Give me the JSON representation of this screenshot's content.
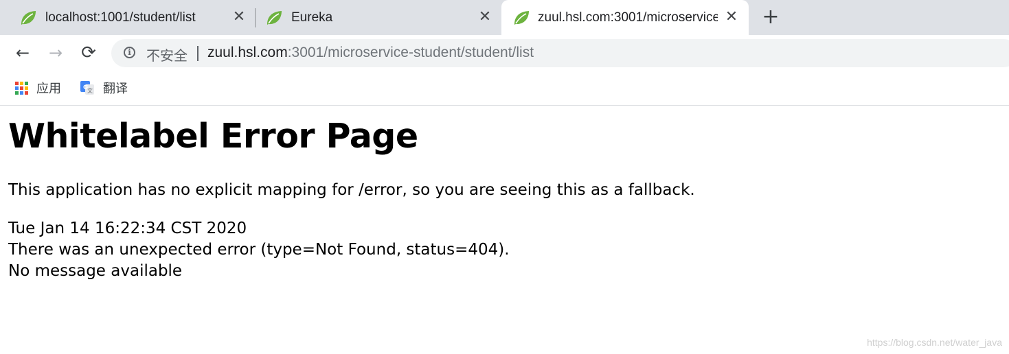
{
  "browser": {
    "tabs": [
      {
        "title": "localhost:1001/student/list",
        "active": false,
        "favicon": "spring-leaf-icon"
      },
      {
        "title": "Eureka",
        "active": false,
        "favicon": "spring-leaf-icon"
      },
      {
        "title": "zuul.hsl.com:3001/microservice",
        "active": true,
        "favicon": "spring-leaf-icon"
      }
    ],
    "new_tab_glyph": "+",
    "close_glyph": "✕",
    "toolbar": {
      "back_glyph": "←",
      "forward_glyph": "→",
      "reload_glyph": "⟳",
      "info_glyph": "i",
      "security_label": "不安全",
      "url_host": "zuul.hsl.com",
      "url_rest": ":3001/microservice-student/student/list"
    },
    "bookmarks": [
      {
        "label": "应用",
        "icon": "apps-grid-icon"
      },
      {
        "label": "翻译",
        "icon": "google-translate-icon"
      }
    ]
  },
  "page": {
    "heading": "Whitelabel Error Page",
    "message": "This application has no explicit mapping for /error, so you are seeing this as a fallback.",
    "timestamp": "Tue Jan 14 16:22:34 CST 2020",
    "error_line": "There was an unexpected error (type=Not Found, status=404).",
    "detail_line": "No message available"
  },
  "watermark": "https://blog.csdn.net/water_java",
  "colors": {
    "tabstrip_bg": "#dee1e6",
    "spring_green": "#6db33f",
    "apps_colors": [
      "#ea4335",
      "#fbbc05",
      "#34a853",
      "#4285f4",
      "#ea4335",
      "#fbbc05",
      "#34a853",
      "#4285f4",
      "#ea4335"
    ]
  }
}
